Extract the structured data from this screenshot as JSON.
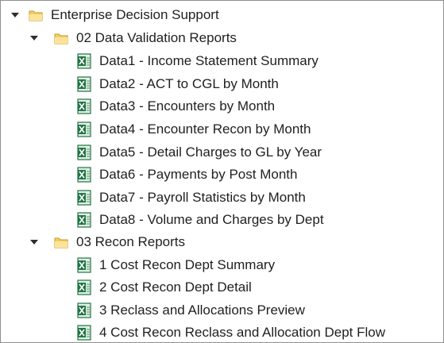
{
  "tree": {
    "root": {
      "label": "Enterprise Decision Support",
      "icon": "folder-icon"
    },
    "folders": [
      {
        "label": "02 Data Validation Reports",
        "icon": "folder-icon",
        "items": [
          {
            "label": "Data1 - Income Statement Summary",
            "icon": "excel-file-icon"
          },
          {
            "label": "Data2 - ACT to CGL by Month",
            "icon": "excel-file-icon"
          },
          {
            "label": "Data3 - Encounters by Month",
            "icon": "excel-file-icon"
          },
          {
            "label": "Data4 - Encounter Recon by Month",
            "icon": "excel-file-icon"
          },
          {
            "label": "Data5 - Detail Charges to GL by Year",
            "icon": "excel-file-icon"
          },
          {
            "label": "Data6 - Payments by Post Month",
            "icon": "excel-file-icon"
          },
          {
            "label": "Data7 - Payroll Statistics by Month",
            "icon": "excel-file-icon"
          },
          {
            "label": "Data8 - Volume and Charges by Dept",
            "icon": "excel-file-icon"
          }
        ]
      },
      {
        "label": "03 Recon Reports",
        "icon": "folder-icon",
        "items": [
          {
            "label": "1 Cost Recon Dept Summary",
            "icon": "excel-file-icon"
          },
          {
            "label": "2 Cost Recon Dept Detail",
            "icon": "excel-file-icon"
          },
          {
            "label": "3 Reclass and Allocations Preview",
            "icon": "excel-file-icon"
          },
          {
            "label": "4 Cost Recon Reclass and Allocation Dept Flow",
            "icon": "excel-file-icon"
          }
        ]
      }
    ]
  },
  "colors": {
    "folder_light": "#f7dc7e",
    "folder_dark": "#d9a832",
    "excel_green": "#217346",
    "excel_light": "#dff0e2"
  }
}
